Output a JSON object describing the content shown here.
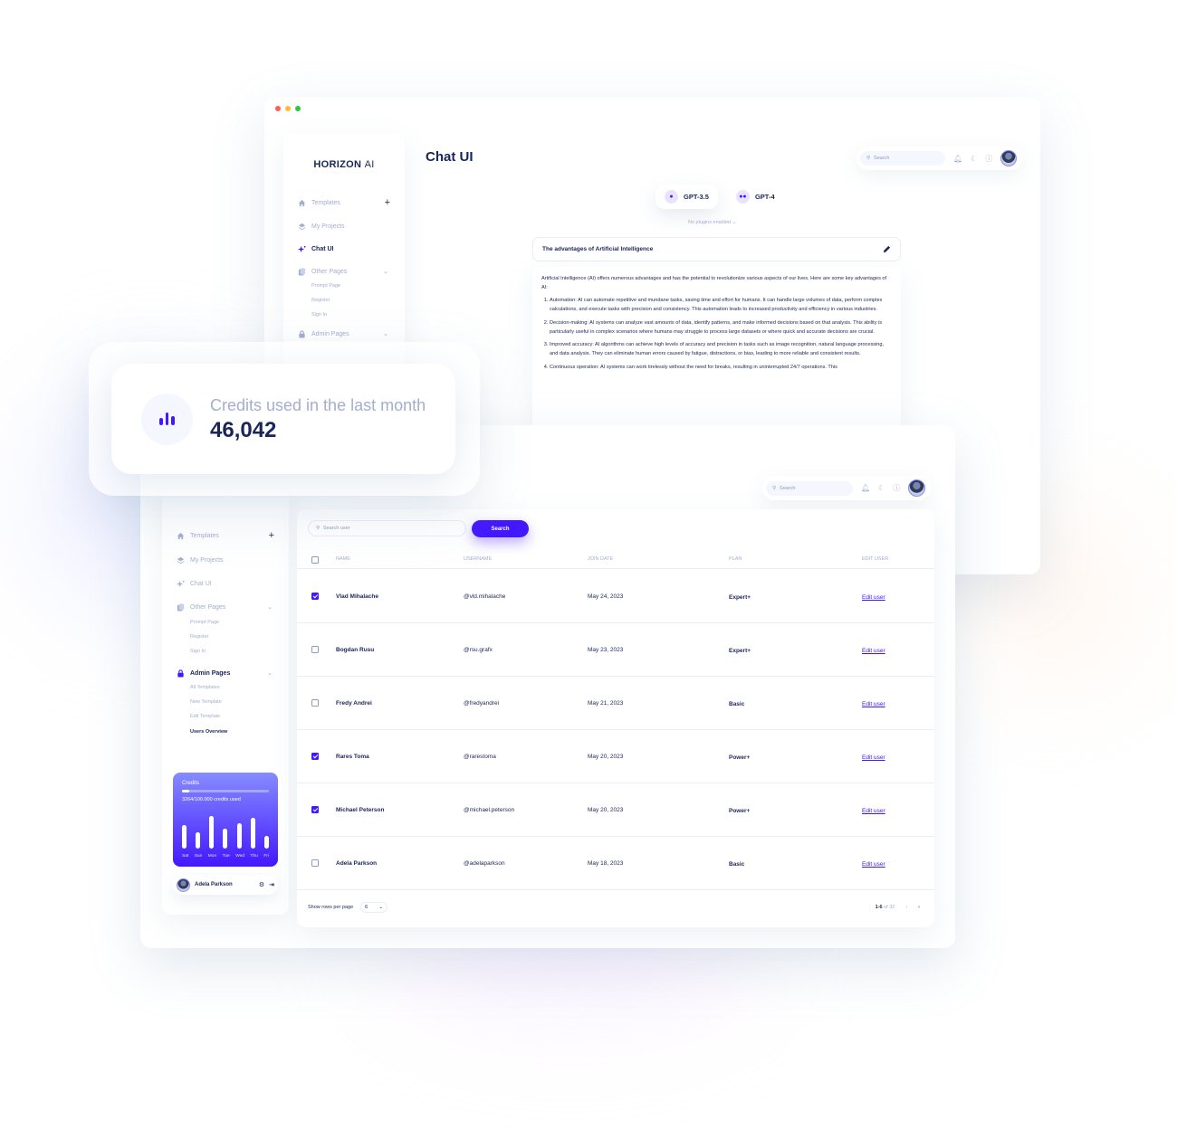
{
  "chat_window": {
    "brand": {
      "bold": "HORIZON",
      "light": "AI"
    },
    "nav": [
      {
        "label": "Templates",
        "icon": "home-icon"
      },
      {
        "label": "My Projects",
        "icon": "layers-icon"
      },
      {
        "label": "Chat UI",
        "icon": "sparkle-icon",
        "active": true
      },
      {
        "label": "Other Pages",
        "icon": "pages-icon"
      },
      {
        "label": "Admin Pages",
        "icon": "lock-icon"
      }
    ],
    "other_pages_sub": [
      "Prompt Page",
      "Register",
      "Sign In"
    ],
    "page_title": "Chat UI",
    "search_placeholder": "Search",
    "models": [
      "GPT-3.5",
      "GPT-4"
    ],
    "plugins_text": "No plugins enabled",
    "prompt": "The advantages of Artificial Intelligence",
    "answer_intro": "Artificial Intelligence (AI) offers numerous advantages and has the potential to revolutionize various aspects of our lives. Here are some key advantages of AI:",
    "answer_items": [
      "Automation: AI can automate repetitive and mundane tasks, saving time and effort for humans. It can handle large volumes of data, perform complex calculations, and execute tasks with precision and consistency. This automation leads to increased productivity and efficiency in various industries.",
      "Decision-making: AI systems can analyze vast amounts of data, identify patterns, and make informed decisions based on that analysis. This ability is particularly useful in complex scenarios where humans may struggle to process large datasets or where quick and accurate decisions are crucial.",
      "Improved accuracy: AI algorithms can achieve high levels of accuracy and precision in tasks such as image recognition, natural language processing, and data analysis. They can eliminate human errors caused by fatigue, distractions, or bias, leading to more reliable and consistent results.",
      "Continuous operation: AI systems can work tirelessly without the need for breaks, resulting in uninterrupted 24/7 operations. This"
    ]
  },
  "stat_card": {
    "label": "Credits used in the last month",
    "value": "46,042",
    "icon": "bar-chart-icon"
  },
  "admin_window": {
    "nav": [
      {
        "label": "Templates"
      },
      {
        "label": "My Projects"
      },
      {
        "label": "Chat UI"
      },
      {
        "label": "Other Pages"
      },
      {
        "label": "Admin Pages",
        "active": true
      }
    ],
    "other_pages_sub": [
      "Prompt Page",
      "Register",
      "Sign In"
    ],
    "admin_pages_sub": [
      "All Templates",
      "New Template",
      "Edit Template",
      "Users Overview"
    ],
    "active_sub": "Users Overview",
    "search_placeholder": "Search",
    "credits": {
      "title": "Credits",
      "used_text": "3264/100.000 credits used",
      "progress": 0.0326,
      "days": [
        "Sat",
        "Sun",
        "Mon",
        "Tue",
        "Wed",
        "Thu",
        "Fri"
      ],
      "bar_levels": [
        0.65,
        0.45,
        0.9,
        0.55,
        0.7,
        0.85,
        0.35
      ]
    },
    "user": {
      "name": "Adela Parkson"
    },
    "table": {
      "search_placeholder": "Search user",
      "search_button": "Search",
      "headers": [
        "NAME",
        "USERNAME",
        "JOIN DATE",
        "PLAN",
        "EDIT USER"
      ],
      "rows": [
        {
          "checked": true,
          "name": "Vlad Mihalache",
          "username": "@vld.mihalache",
          "date": "May 24, 2023",
          "plan": "Expert+",
          "edit": "Edit user"
        },
        {
          "checked": false,
          "name": "Bogdan Rusu",
          "username": "@rsu.grafx",
          "date": "May 23, 2023",
          "plan": "Expert+",
          "edit": "Edit user"
        },
        {
          "checked": false,
          "name": "Fredy Andrei",
          "username": "@fredyandrei",
          "date": "May 21, 2023",
          "plan": "Basic",
          "edit": "Edit user"
        },
        {
          "checked": true,
          "name": "Rares Toma",
          "username": "@rarestoma",
          "date": "May 20, 2023",
          "plan": "Power+",
          "edit": "Edit user"
        },
        {
          "checked": true,
          "name": "Michael Peterson",
          "username": "@michael.peterson",
          "date": "May 20, 2023",
          "plan": "Power+",
          "edit": "Edit user"
        },
        {
          "checked": false,
          "name": "Adela Parkson",
          "username": "@adelaparkson",
          "date": "May 18, 2023",
          "plan": "Basic",
          "edit": "Edit user"
        }
      ],
      "rows_per_page_label": "Show rows per page",
      "rows_per_page": "6",
      "range": "1-6",
      "of_label": "of 32"
    }
  },
  "colors": {
    "brand": "#4318FF",
    "navy": "#1B2559",
    "muted": "#A3AED0",
    "dot_red": "#FF5F57",
    "dot_yellow": "#FEBC2E",
    "dot_green": "#28C840"
  }
}
